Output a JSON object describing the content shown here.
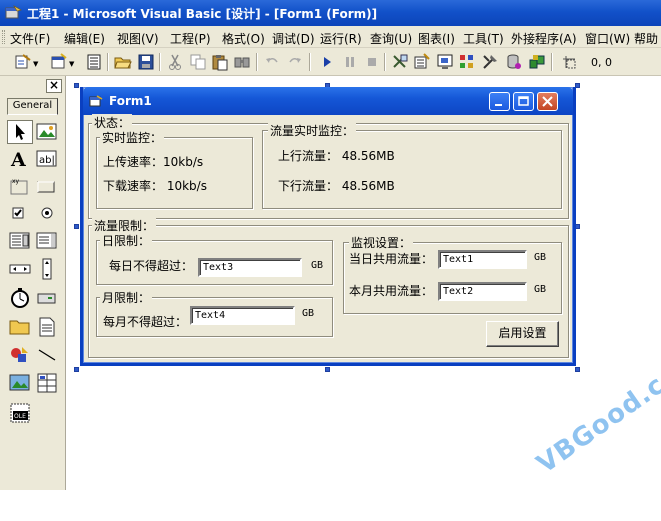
{
  "ide": {
    "title": "工程1 - Microsoft Visual Basic [设计] - [Form1 (Form)]"
  },
  "menu": [
    "文件(F)",
    "编辑(E)",
    "视图(V)",
    "工程(P)",
    "格式(O)",
    "调试(D)",
    "运行(R)",
    "查询(U)",
    "图表(I)",
    "工具(T)",
    "外接程序(A)",
    "窗口(W)",
    "帮助"
  ],
  "toolbar": {
    "coords": "0, 0",
    "icons": [
      "add-project-icon",
      "add-form-icon",
      "menu-editor-icon",
      "open-icon",
      "save-icon",
      "cut-icon",
      "copy-icon",
      "paste-icon",
      "find-icon",
      "undo-icon",
      "redo-icon",
      "start-icon",
      "break-icon",
      "end-icon",
      "project-explorer-icon",
      "properties-icon",
      "form-layout-icon",
      "object-browser-icon",
      "toolbox-icon",
      "data-view-icon",
      "component-manager-icon",
      "position-icon"
    ]
  },
  "toolbox": {
    "tab_label": "General",
    "close": "×",
    "tools": [
      "pointer",
      "picturebox",
      "label",
      "textbox",
      "frame",
      "commandbutton",
      "checkbox",
      "optionbutton",
      "combobox",
      "listbox",
      "hscrollbar",
      "vscrollbar",
      "timer",
      "drivelistbox",
      "dirlistbox",
      "filelistbox",
      "shape",
      "line",
      "image",
      "data",
      "ole"
    ]
  },
  "form": {
    "title": "Form1",
    "status_frame": "状态：",
    "realtime_frame": "实时监控：",
    "upload_label": "上传速率：10kb/s",
    "download_label": "下载速率： 10kb/s",
    "traffic_frame": "流量实时监控：",
    "up_traffic": "上行流量： 48.56MB",
    "down_traffic": "下行流量： 48.56MB",
    "limit_frame": "流量限制：",
    "daily_frame": "日限制：",
    "daily_label": "每日不得超过：",
    "daily_text": "Text3",
    "daily_unit": "GB",
    "monthly_frame": "月限制：",
    "monthly_label": "每月不得超过：",
    "monthly_text": "Text4",
    "monthly_unit": "GB",
    "monitor_frame": "监视设置：",
    "today_label": "当日共用流量：",
    "today_text": "Text1",
    "today_unit": "GB",
    "month_label": "本月共用流量：",
    "month_text": "Text2",
    "month_unit": "GB",
    "apply_button": "启用设置"
  },
  "watermark": "VBGood.com",
  "colors": {
    "title_blue": "#0c44b9",
    "face": "#ece9d8",
    "handle": "#2f5ac8",
    "watermark": "#8fc3f0"
  }
}
